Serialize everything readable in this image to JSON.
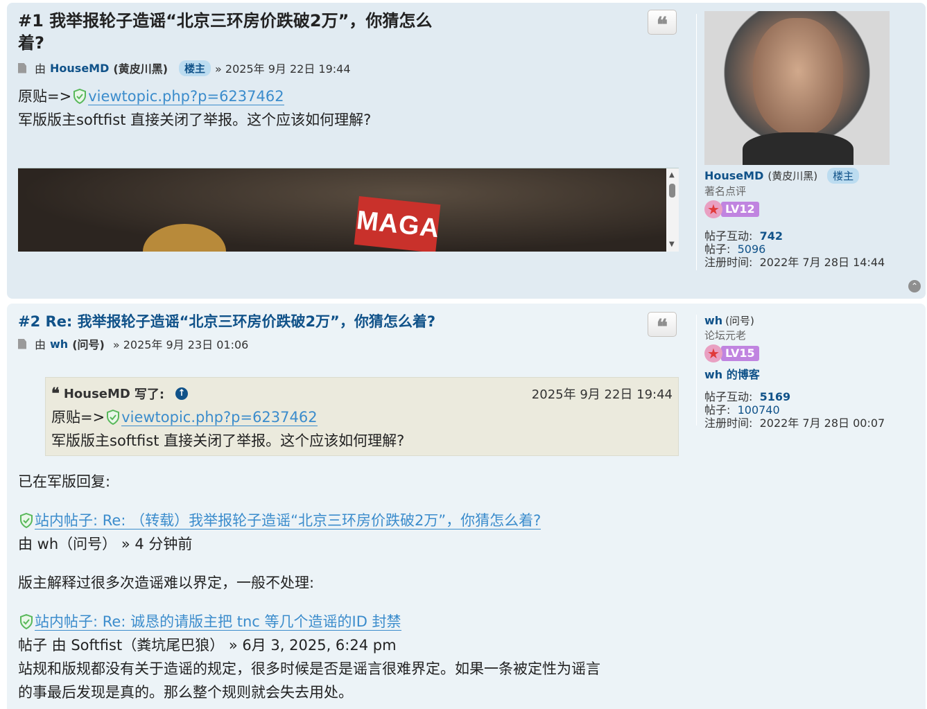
{
  "post1": {
    "title_line1": "#1 我举报轮子造谣“北京三环房价跌破2万”，你猜怎么",
    "title_line2": "着?",
    "by": "由",
    "author": "HouseMD",
    "author_alias": "(黄皮川黑)",
    "owner_badge": "楼主",
    "date": "» 2025年 9月 22日 19:44",
    "content": {
      "orig_prefix": "原贴=>",
      "orig_link": "viewtopic.php?p=6237462",
      "text": "军版版主softfist 直接关闭了举报。这个应该如何理解?"
    },
    "image_flag_text": "MAGA",
    "profile": {
      "name": "HouseMD",
      "alias": "(黄皮川黑)",
      "badge": "楼主",
      "rank": "著名点评",
      "level": "LV12",
      "interaction_label": "帖子互动:",
      "interaction_value": "742",
      "posts_label": "帖子:",
      "posts_value": "5096",
      "joined_label": "注册时间:",
      "joined_value": "2022年 7月 28日 14:44"
    }
  },
  "post2": {
    "title": "#2 Re: 我举报轮子造谣“北京三环房价跌破2万”，你猜怎么着?",
    "by": "由",
    "author": "wh",
    "author_alias": "(问号)",
    "date": "» 2025年 9月 23日 01:06",
    "quote": {
      "author": "HouseMD",
      "wrote": "写了:",
      "date": "2025年 9月 22日 19:44",
      "orig_prefix": "原贴=>",
      "orig_link": "viewtopic.php?p=6237462",
      "text": "军版版主softfist 直接关闭了举报。这个应该如何理解?"
    },
    "body": {
      "line1": "已在军版回复:",
      "link1": "站内帖子: Re: （转载）我举报轮子造谣“北京三环房价跌破2万”，你猜怎么着?",
      "meta1": "由 wh（问号） » 4 分钟前",
      "line2": "版主解释过很多次造谣难以界定，一般不处理:",
      "link2": "站内帖子: Re: 诚恳的请版主把 tnc 等几个造谣的ID 封禁",
      "meta2": "帖子 由 Softfist（粪坑尾巴狼） » 6月 3, 2025, 6:24 pm",
      "line3": "站规和版规都没有关于造谣的规定，很多时候是否是谣言很难界定。如果一条被定性为谣言",
      "line4": "的事最后发现是真的。那么整个规则就会失去用处。"
    },
    "profile": {
      "name": "wh",
      "alias": "(问号)",
      "rank": "论坛元老",
      "level": "LV15",
      "blog": "wh 的博客",
      "interaction_label": "帖子互动:",
      "interaction_value": "5169",
      "posts_label": "帖子:",
      "posts_value": "100740",
      "joined_label": "注册时间:",
      "joined_value": "2022年 7月 28日 00:07"
    }
  },
  "colors": {
    "link": "#105289",
    "post_bg_1": "#e1ebf2",
    "post_bg_2": "#ecf3f7",
    "quote_bg": "#ebeadd"
  }
}
